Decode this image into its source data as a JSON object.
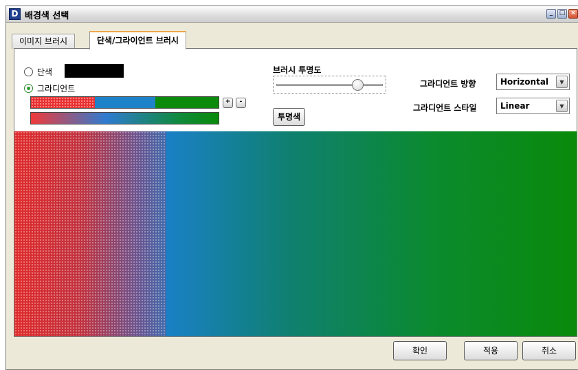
{
  "window": {
    "title": "배경색 선택",
    "icon_letter": "D"
  },
  "tabs": [
    {
      "label": "이미지 브러시"
    },
    {
      "label": "단색/그라이언트 브러시"
    }
  ],
  "fill": {
    "solid_label": "단색",
    "gradient_label": "그라디언트",
    "selected": "gradient",
    "solid_color": "#000000"
  },
  "gradient_stops": [
    {
      "color": "#e63232"
    },
    {
      "color": "#1e82c8"
    },
    {
      "color": "#0c8a0c"
    }
  ],
  "stop_buttons": {
    "add": "+",
    "remove": "-"
  },
  "opacity": {
    "label": "브러시 투명도",
    "value_fraction": 0.8
  },
  "transparent_button": "투명색",
  "direction": {
    "label": "그라디언트 방향",
    "value": "Horizontal"
  },
  "style": {
    "label": "그라디언트 스타일",
    "value": "Linear"
  },
  "footer": {
    "ok": "확인",
    "apply": "적용",
    "cancel": "취소"
  },
  "colors": {
    "accent_tab": "#f0a64a",
    "red": "#e63232",
    "blue": "#1e82c8",
    "green": "#0c8a0c"
  }
}
